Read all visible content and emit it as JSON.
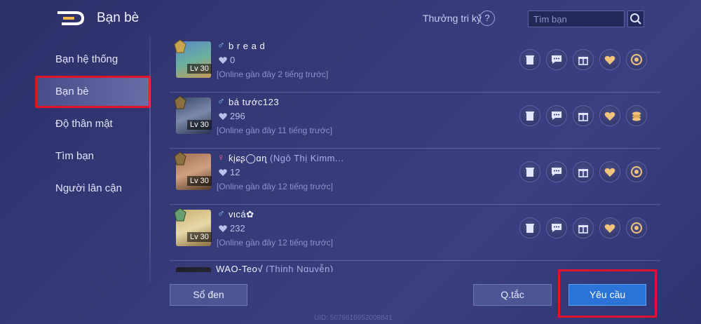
{
  "header": {
    "title": "Bạn bè",
    "rule_text": "Thưởng tri kỷ",
    "help_label": "?",
    "search_placeholder": "Tìm bạn"
  },
  "sidebar": {
    "items": [
      {
        "label": "Bạn hệ thống",
        "active": false
      },
      {
        "label": "Bạn bè",
        "active": true
      },
      {
        "label": "Độ thân mật",
        "active": false
      },
      {
        "label": "Tìm bạn",
        "active": false
      },
      {
        "label": "Người lân cận",
        "active": false
      }
    ]
  },
  "friends": [
    {
      "gender": "♂",
      "name": "b r e a d",
      "alias": "",
      "level": "Lv 30",
      "hearts": "0",
      "online": "[Online gần đây 2 tiếng trước]"
    },
    {
      "gender": "♂",
      "name": "bá tước123",
      "alias": "",
      "level": "Lv 30",
      "hearts": "296",
      "online": "[Online gần đây 11 tiếng trước]"
    },
    {
      "gender": "♀",
      "name": "ƙįɕʂ◯ɑɳ",
      "alias": "(Ngô Thị Kimm...",
      "level": "Lv 30",
      "hearts": "12",
      "online": "[Online gần đây 12 tiếng trước]"
    },
    {
      "gender": "♂",
      "name": "vιcá✿",
      "alias": "",
      "level": "Lv 30",
      "hearts": "232",
      "online": "[Online gần đây 12 tiếng trước]"
    },
    {
      "gender": "",
      "name": "WAO-Teo√",
      "alias": "(Thịnh Nguyễn)",
      "level": "",
      "hearts": "",
      "online": ""
    }
  ],
  "footer": {
    "blacklist_label": "Sổ đen",
    "rule_label": "Q.tắc",
    "request_label": "Yêu cầu",
    "uid": "UID: 5079616952009841"
  },
  "colors": {
    "male": "#8fc9ff",
    "female": "#ff5b8a",
    "highlight": "#e3122b",
    "primary_button": "#2b73d6"
  }
}
